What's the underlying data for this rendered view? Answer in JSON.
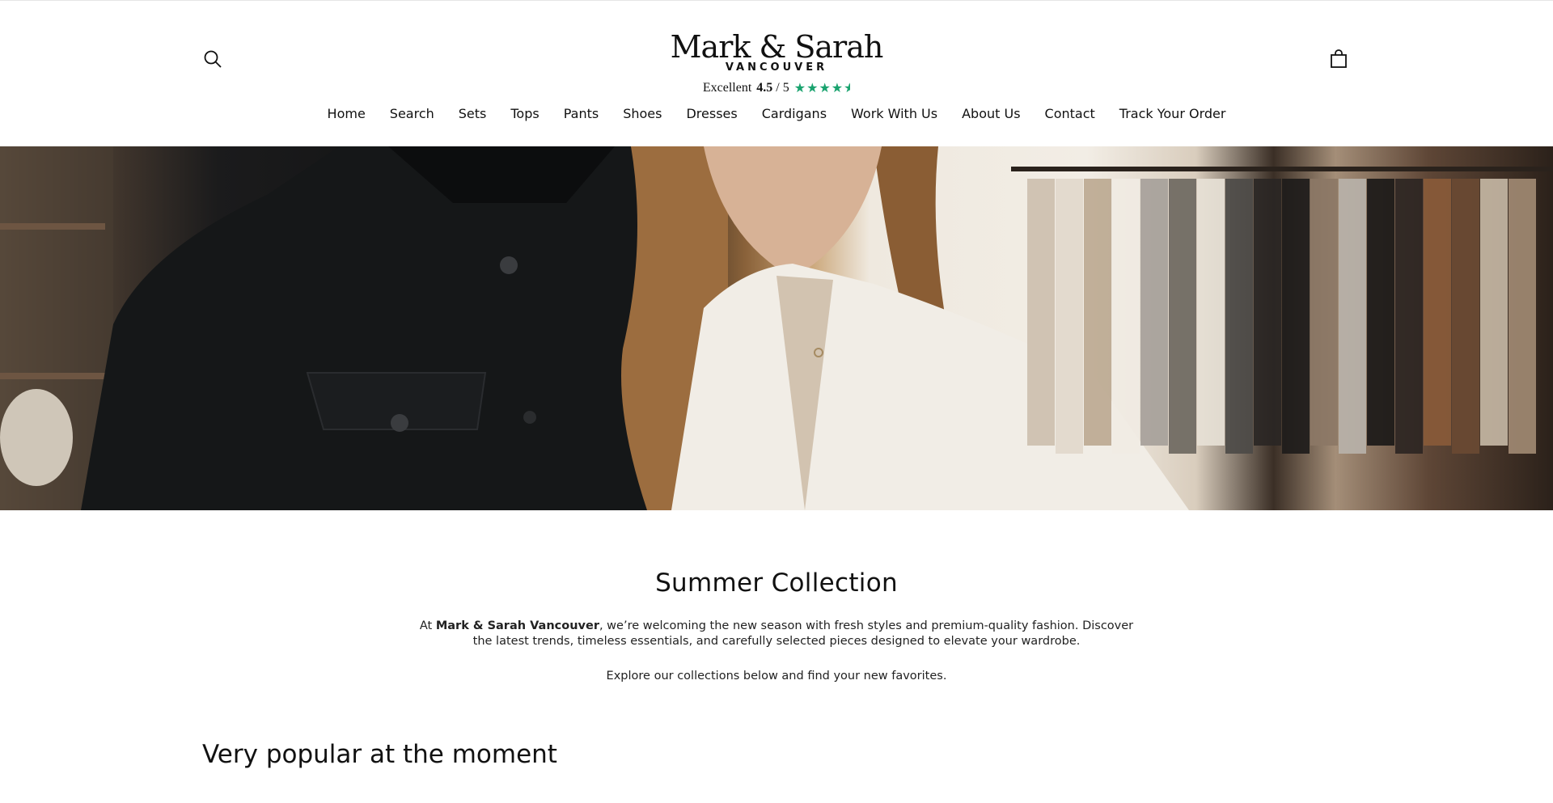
{
  "header": {
    "brand_name": "Mark & Sarah",
    "brand_city": "VANCOUVER",
    "rating": {
      "label": "Excellent",
      "score": "4.5",
      "scale": "/ 5",
      "stars": 4.5,
      "star_color": "#1aa36f"
    },
    "search_icon": "search-icon",
    "cart_icon": "shopping-bag-icon"
  },
  "nav": {
    "items": [
      {
        "label": "Home"
      },
      {
        "label": "Search"
      },
      {
        "label": "Sets"
      },
      {
        "label": "Tops"
      },
      {
        "label": "Pants"
      },
      {
        "label": "Shoes"
      },
      {
        "label": "Dresses"
      },
      {
        "label": "Cardigans"
      },
      {
        "label": "Work With Us"
      },
      {
        "label": "About Us"
      },
      {
        "label": "Contact"
      },
      {
        "label": "Track Your Order"
      }
    ]
  },
  "intro": {
    "title": "Summer Collection",
    "para1_prefix": "At ",
    "para1_brand": "Mark & Sarah Vancouver",
    "para1_rest": ", we’re welcoming the new season with fresh styles and premium-quality fashion. Discover the latest trends, timeless essentials, and carefully selected pieces designed to elevate your wardrobe.",
    "para2": "Explore our collections below and find your new favorites."
  },
  "sections": {
    "popular_title": "Very popular at the moment"
  }
}
